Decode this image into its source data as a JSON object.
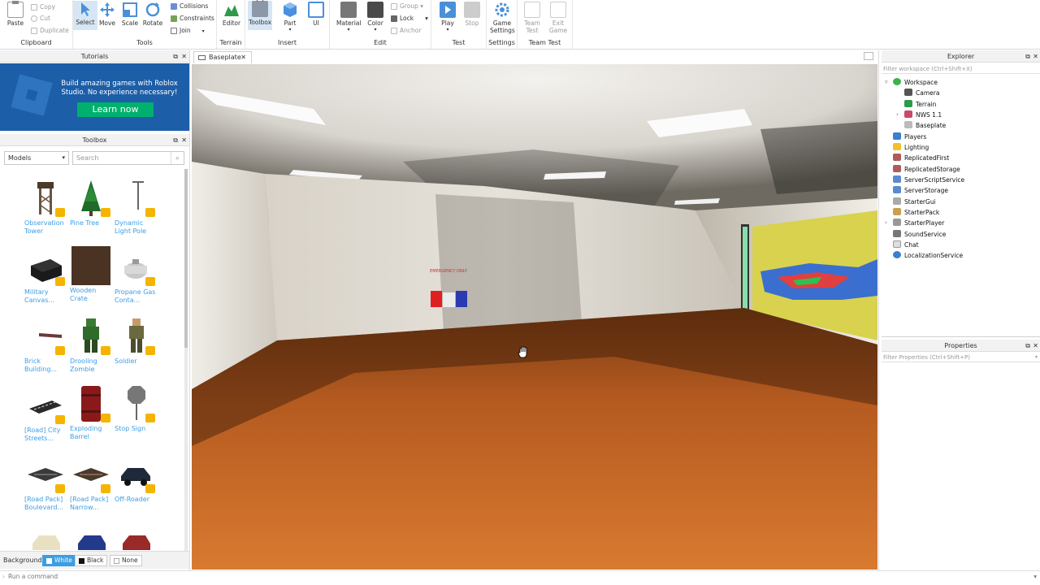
{
  "ribbon": {
    "clipboard": {
      "label": "Clipboard",
      "paste": "Paste",
      "copy": "Copy",
      "cut": "Cut",
      "duplicate": "Duplicate"
    },
    "tools": {
      "label": "Tools",
      "select": "Select",
      "move": "Move",
      "scale": "Scale",
      "rotate": "Rotate",
      "collisions": "Collisions",
      "constraints": "Constraints",
      "join": "Join"
    },
    "terrain": {
      "label": "Terrain",
      "editor": "Editor"
    },
    "insert": {
      "label": "Insert",
      "toolbox": "Toolbox",
      "part": "Part",
      "ui": "UI"
    },
    "edit": {
      "label": "Edit",
      "material": "Material",
      "color": "Color",
      "group": "Group",
      "lock": "Lock",
      "anchor": "Anchor"
    },
    "test": {
      "label": "Test",
      "play": "Play",
      "stop": "Stop"
    },
    "settings": {
      "label": "Settings",
      "game_settings_1": "Game",
      "game_settings_2": "Settings"
    },
    "team_test": {
      "label": "Team Test",
      "team_1": "Team",
      "team_2": "Test",
      "exit_1": "Exit",
      "exit_2": "Game"
    }
  },
  "tutorials": {
    "title": "Tutorials",
    "banner_text": "Build amazing games with Roblox Studio. No experience necessary!",
    "button": "Learn now"
  },
  "toolbox": {
    "title": "Toolbox",
    "category": "Models",
    "search_placeholder": "Search",
    "items": [
      {
        "label": "Observation Tower"
      },
      {
        "label": "Pine Tree"
      },
      {
        "label": "Dynamic Light Pole"
      },
      {
        "label": "Military Canvas..."
      },
      {
        "label": "Wooden Crate"
      },
      {
        "label": "Propane Gas Conta..."
      },
      {
        "label": "Brick Building..."
      },
      {
        "label": "Drooling Zombie"
      },
      {
        "label": "Soldier"
      },
      {
        "label": "[Road] City Streets..."
      },
      {
        "label": "Exploding Barrel"
      },
      {
        "label": "Stop Sign"
      },
      {
        "label": "[Road Pack] Boulevard..."
      },
      {
        "label": "[Road Pack] Narrow..."
      },
      {
        "label": "Off-Roader"
      }
    ],
    "background_label": "Background:",
    "bg_white": "White",
    "bg_black": "Black",
    "bg_none": "None"
  },
  "viewport": {
    "tab": "Baseplate",
    "sign": "EMERGENCY ONLY"
  },
  "explorer": {
    "title": "Explorer",
    "filter_placeholder": "Filter workspace (Ctrl+Shift+X)",
    "items": [
      {
        "label": "Workspace"
      },
      {
        "label": "Camera"
      },
      {
        "label": "Terrain"
      },
      {
        "label": "NWS 1.1"
      },
      {
        "label": "Baseplate"
      },
      {
        "label": "Players"
      },
      {
        "label": "Lighting"
      },
      {
        "label": "ReplicatedFirst"
      },
      {
        "label": "ReplicatedStorage"
      },
      {
        "label": "ServerScriptService"
      },
      {
        "label": "ServerStorage"
      },
      {
        "label": "StarterGui"
      },
      {
        "label": "StarterPack"
      },
      {
        "label": "StarterPlayer"
      },
      {
        "label": "SoundService"
      },
      {
        "label": "Chat"
      },
      {
        "label": "LocalizationService"
      }
    ]
  },
  "properties": {
    "title": "Properties",
    "filter_placeholder": "Filter Properties (Ctrl+Shift+P)"
  },
  "command_bar": {
    "placeholder": "Run a command"
  }
}
